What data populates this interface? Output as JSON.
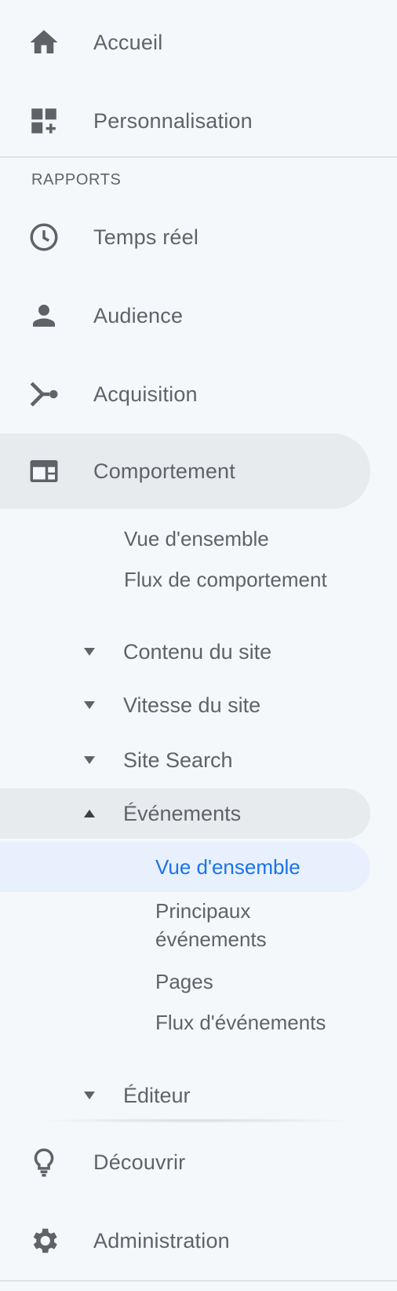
{
  "nav": {
    "home_label": "Accueil",
    "custom_label": "Personnalisation",
    "section_label": "RAPPORTS",
    "realtime_label": "Temps réel",
    "audience_label": "Audience",
    "acquisition_label": "Acquisition",
    "behavior_label": "Comportement",
    "behavior_sub": {
      "overview": "Vue d'ensemble",
      "flow": "Flux de comportement"
    },
    "groups": {
      "site_content": "Contenu du site",
      "site_speed": "Vitesse du site",
      "site_search": "Site Search",
      "events": "Événements",
      "publisher": "Éditeur"
    },
    "events_sub": {
      "overview": "Vue d'ensemble",
      "top_events": "Principaux événements",
      "pages": "Pages",
      "events_flow": "Flux d'événements"
    },
    "discover_label": "Découvrir",
    "admin_label": "Administration"
  },
  "colors": {
    "text": "#5f6368",
    "icon": "#5f6368",
    "selected_text": "#1a73e8",
    "selected_bg": "#e8f0fe",
    "active_bg": "#e8ebee",
    "background": "#f5f8fa"
  },
  "icons": {
    "home": "home-icon",
    "custom": "dashboard-add-icon",
    "realtime": "clock-icon",
    "audience": "person-icon",
    "acquisition": "merge-icon",
    "behavior": "web-layout-icon",
    "discover": "lightbulb-icon",
    "admin": "gear-icon",
    "collapsed": "triangle-down-icon",
    "expanded": "triangle-up-icon"
  }
}
